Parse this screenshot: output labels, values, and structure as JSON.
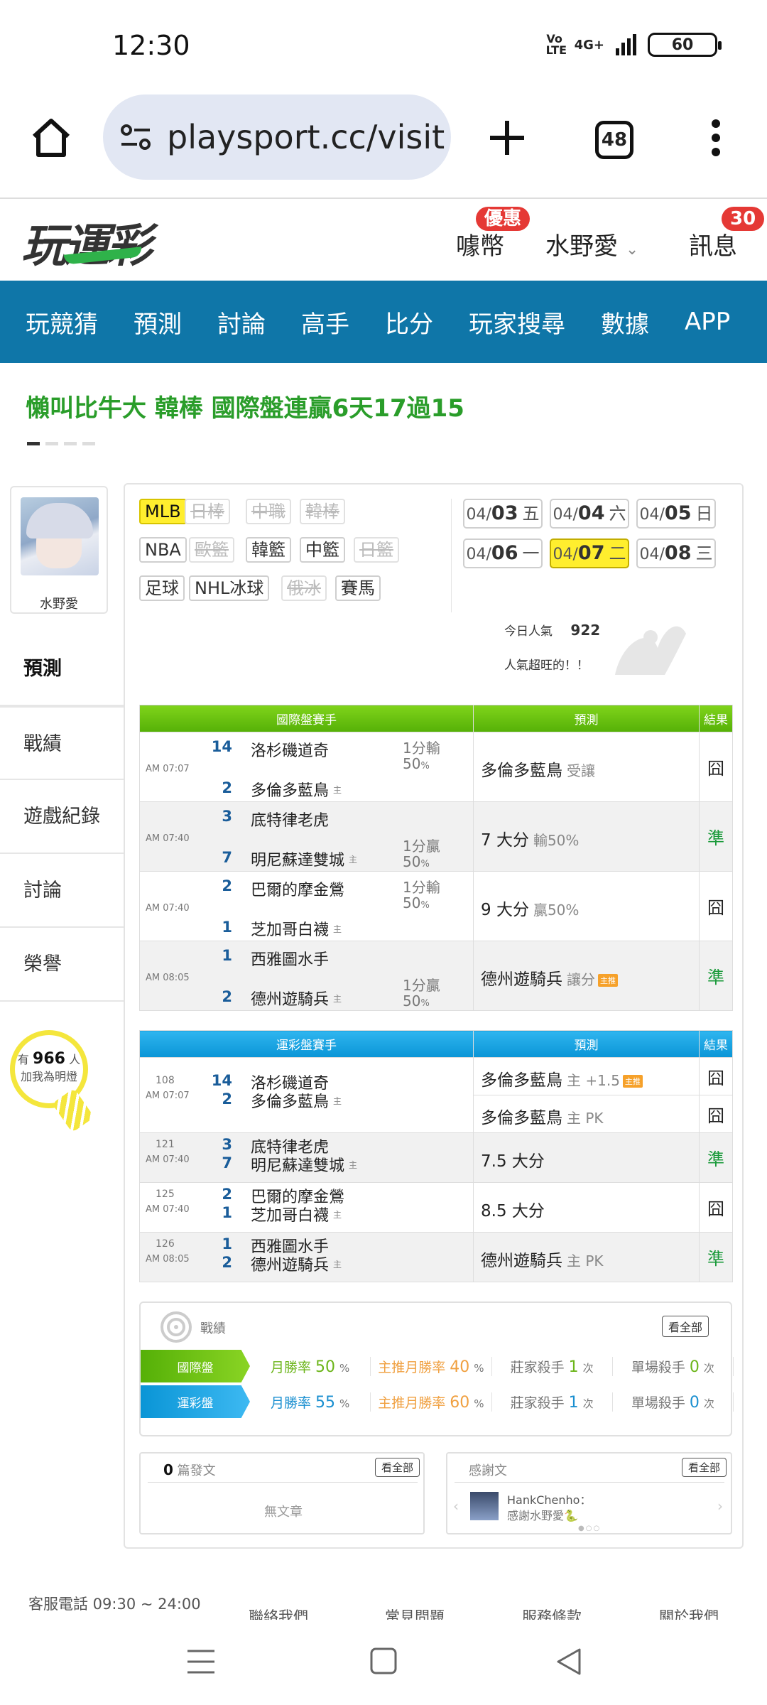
{
  "status": {
    "time": "12:30",
    "battery": "60",
    "network": "4G+",
    "volte": "Vo LTE"
  },
  "browser": {
    "url": "playsport.cc/visit",
    "tab_count": "48"
  },
  "site": {
    "logo": "玩運彩",
    "coin": "噱幣",
    "coin_badge": "優惠",
    "user": "水野愛",
    "messages": "訊息",
    "messages_badge": "30"
  },
  "nav": [
    "玩競猜",
    "預測",
    "討論",
    "高手",
    "比分",
    "玩家搜尋",
    "數據",
    "APP"
  ],
  "headline": "懶叫比牛大 韓棒 國際盤連贏6天17過15",
  "sidebar": {
    "username": "水野愛",
    "menu": [
      "預測",
      "戰績",
      "遊戲紀錄",
      "討論",
      "榮譽"
    ],
    "fans_prefix": "有",
    "fans_count": "966",
    "fans_unit": "人",
    "fans_cta": "加我為明燈"
  },
  "leagues": [
    {
      "label": "MLB",
      "state": "selected"
    },
    {
      "label": "日棒",
      "state": "disabled"
    },
    {
      "label": "中職",
      "state": "disabled"
    },
    {
      "label": "韓棒",
      "state": "disabled"
    },
    {
      "label": "NBA",
      "state": "normal"
    },
    {
      "label": "歐籃",
      "state": "disabled"
    },
    {
      "label": "韓籃",
      "state": "normal"
    },
    {
      "label": "中籃",
      "state": "normal"
    },
    {
      "label": "日籃",
      "state": "disabled"
    },
    {
      "label": "足球",
      "state": "normal"
    },
    {
      "label": "NHL冰球",
      "state": "normal"
    },
    {
      "label": "俄冰",
      "state": "disabled"
    },
    {
      "label": "賽馬",
      "state": "normal"
    }
  ],
  "dates": [
    {
      "md": "04/",
      "day": "03",
      "wd": "五",
      "selected": false
    },
    {
      "md": "04/",
      "day": "04",
      "wd": "六",
      "selected": false
    },
    {
      "md": "04/",
      "day": "05",
      "wd": "日",
      "selected": false
    },
    {
      "md": "04/",
      "day": "06",
      "wd": "一",
      "selected": false
    },
    {
      "md": "04/",
      "day": "07",
      "wd": "二",
      "selected": true
    },
    {
      "md": "04/",
      "day": "08",
      "wd": "三",
      "selected": false
    }
  ],
  "popularity": {
    "label": "今日人氣",
    "value": "922",
    "note": "人氣超旺的！！"
  },
  "intl_table": {
    "headers": [
      "國際盤賽手",
      "預測",
      "結果"
    ],
    "rows": [
      {
        "time": "AM 07:07",
        "away_score": "14",
        "away": "洛杉磯道奇",
        "home_score": "2",
        "home": "多倫多藍鳥",
        "line": "1分輸",
        "pct": "50",
        "line_pos": "top",
        "pick": "多倫多藍鳥",
        "pick_note": "受讓",
        "result": "囧",
        "ok": false
      },
      {
        "time": "AM 07:40",
        "away_score": "3",
        "away": "底特律老虎",
        "home_score": "7",
        "home": "明尼蘇達雙城",
        "line": "1分贏",
        "pct": "50",
        "line_pos": "bottom",
        "pick": "7 大分",
        "pick_note": "輸50%",
        "result": "準",
        "ok": true
      },
      {
        "time": "AM 07:40",
        "away_score": "2",
        "away": "巴爾的摩金鶯",
        "home_score": "1",
        "home": "芝加哥白襪",
        "line": "1分輸",
        "pct": "50",
        "line_pos": "top",
        "pick": "9 大分",
        "pick_note": "贏50%",
        "result": "囧",
        "ok": false
      },
      {
        "time": "AM 08:05",
        "away_score": "1",
        "away": "西雅圖水手",
        "home_score": "2",
        "home": "德州遊騎兵",
        "line": "1分贏",
        "pct": "50",
        "line_pos": "bottom",
        "pick": "德州遊騎兵",
        "pick_note": "讓分",
        "tag": "主推",
        "result": "準",
        "ok": true
      }
    ]
  },
  "tw_table": {
    "headers": [
      "運彩盤賽手",
      "預測",
      "結果"
    ],
    "rows": [
      {
        "id": "108",
        "time": "AM 07:07",
        "away_score": "14",
        "away": "洛杉磯道奇",
        "home_score": "2",
        "home": "多倫多藍鳥",
        "picks": [
          {
            "team": "多倫多藍鳥",
            "note": "主 +1.5",
            "tag": "主推",
            "result": "囧",
            "ok": false
          },
          {
            "team": "多倫多藍鳥",
            "note": "主 PK",
            "result": "囧",
            "ok": false
          }
        ]
      },
      {
        "id": "121",
        "time": "AM 07:40",
        "away_score": "3",
        "away": "底特律老虎",
        "home_score": "7",
        "home": "明尼蘇達雙城",
        "picks": [
          {
            "team": "7.5 大分",
            "note": "",
            "result": "準",
            "ok": true
          }
        ]
      },
      {
        "id": "125",
        "time": "AM 07:40",
        "away_score": "2",
        "away": "巴爾的摩金鶯",
        "home_score": "1",
        "home": "芝加哥白襪",
        "picks": [
          {
            "team": "8.5 大分",
            "note": "",
            "result": "囧",
            "ok": false
          }
        ]
      },
      {
        "id": "126",
        "time": "AM 08:05",
        "away_score": "1",
        "away": "西雅圖水手",
        "home_score": "2",
        "home": "德州遊騎兵",
        "picks": [
          {
            "team": "德州遊騎兵",
            "note": "主 PK",
            "result": "準",
            "ok": true
          }
        ]
      }
    ],
    "home_mark": "主"
  },
  "record": {
    "title": "戰績",
    "view_all": "看全部",
    "rows": [
      {
        "label": "國際盤",
        "monthly": "月勝率",
        "monthly_v": "50",
        "main": "主推月勝率",
        "main_v": "40",
        "kill": "莊家殺手",
        "kill_v": "1",
        "single": "單場殺手",
        "single_v": "0",
        "unit_pct": "%",
        "unit_times": "次"
      },
      {
        "label": "運彩盤",
        "monthly": "月勝率",
        "monthly_v": "55",
        "main": "主推月勝率",
        "main_v": "60",
        "kill": "莊家殺手",
        "kill_v": "1",
        "single": "單場殺手",
        "single_v": "0",
        "unit_pct": "%",
        "unit_times": "次"
      }
    ]
  },
  "posts": {
    "count": "0",
    "label": "篇發文",
    "view_all": "看全部",
    "empty": "無文章"
  },
  "thanks": {
    "label": "感謝文",
    "view_all": "看全部",
    "user": "HankChenho：",
    "text": "感謝水野愛🐍"
  },
  "footer": {
    "phone": "客服電話 09:30 ~ 24:00",
    "links": [
      "聯絡我們",
      "常見問題",
      "服務條款",
      "關於我們"
    ]
  },
  "colors": {
    "nav_blue": "#0f76a8",
    "green": "#55b007",
    "blue": "#0a95d6",
    "highlight": "#ffee2e",
    "red": "#e53935"
  }
}
